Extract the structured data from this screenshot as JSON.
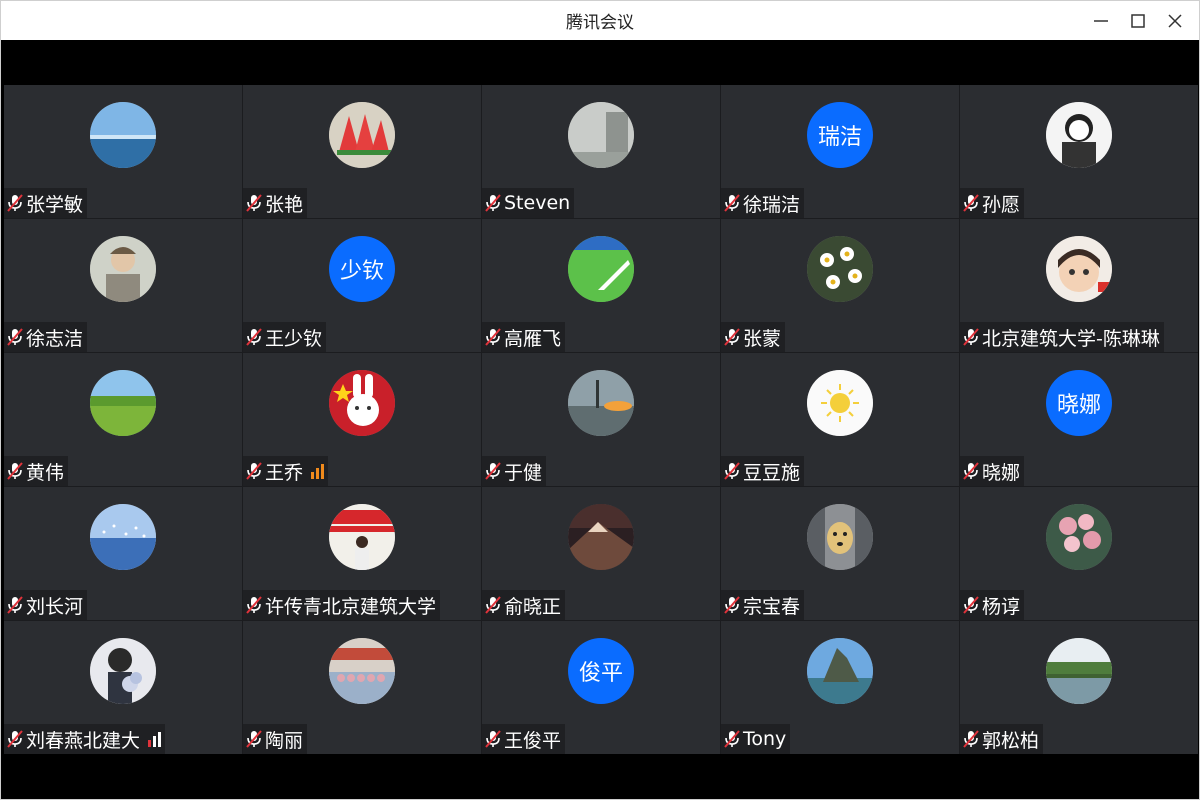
{
  "window": {
    "title": "腾讯会议"
  },
  "participants": [
    {
      "name": "张学敏",
      "avatar": "photo-sea-icon"
    },
    {
      "name": "张艳",
      "avatar": "photo-watermelon-icon"
    },
    {
      "name": "Steven",
      "avatar": "photo-fog-icon"
    },
    {
      "name": "徐瑞洁",
      "avatar_text": "瑞洁"
    },
    {
      "name": "孙愿",
      "avatar": "photo-sketch-man-icon"
    },
    {
      "name": "徐志洁",
      "avatar": "photo-man-portrait-icon"
    },
    {
      "name": "王少钦",
      "avatar_text": "少钦"
    },
    {
      "name": "高雁飞",
      "avatar": "photo-green-field-icon"
    },
    {
      "name": "张蒙",
      "avatar": "photo-daisies-icon"
    },
    {
      "name": "北京建筑大学-陈琳琳",
      "avatar": "photo-cartoon-girl-icon"
    },
    {
      "name": "黄伟",
      "avatar": "photo-meadow-icon"
    },
    {
      "name": "王乔",
      "avatar": "photo-rabbit-flag-icon",
      "signal": "orange"
    },
    {
      "name": "于健",
      "avatar": "photo-sunset-tower-icon"
    },
    {
      "name": "豆豆施",
      "avatar": "photo-sun-icon"
    },
    {
      "name": "晓娜",
      "avatar_text": "晓娜"
    },
    {
      "name": "刘长河",
      "avatar": "photo-birds-water-icon"
    },
    {
      "name": "许传青北京建筑大学",
      "avatar": "photo-banner-speaker-icon"
    },
    {
      "name": "俞晓正",
      "avatar": "photo-mountain-icon"
    },
    {
      "name": "宗宝春",
      "avatar": "photo-dog-icon"
    },
    {
      "name": "杨谆",
      "avatar": "photo-flowers-icon"
    },
    {
      "name": "刘春燕北建大",
      "avatar": "photo-girl-flowers-icon",
      "signal": "red-white"
    },
    {
      "name": "陶丽",
      "avatar": "photo-group-icon"
    },
    {
      "name": "王俊平",
      "avatar_text": "俊平"
    },
    {
      "name": "Tony",
      "avatar": "photo-rock-island-icon"
    },
    {
      "name": "郭松柏",
      "avatar": "photo-lake-icon"
    }
  ]
}
